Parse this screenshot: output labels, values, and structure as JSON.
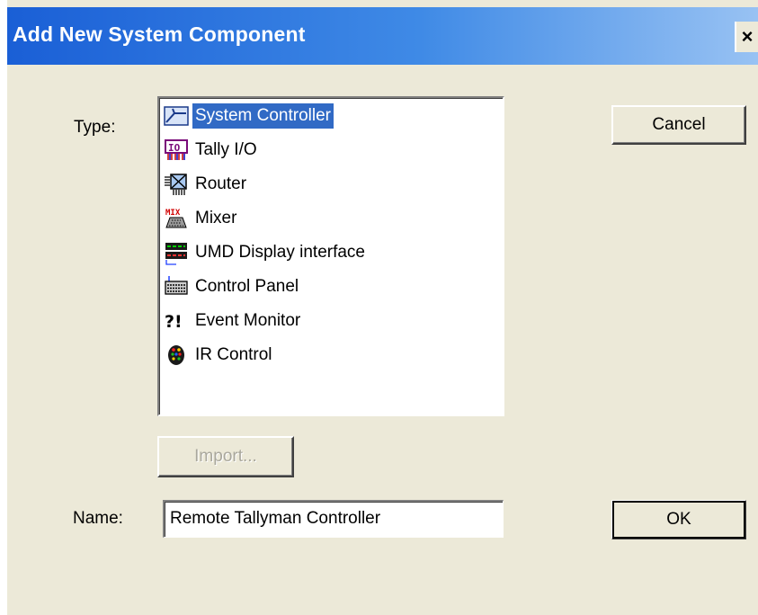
{
  "dialog": {
    "title": "Add New System Component",
    "close_label": "×"
  },
  "type_label": "Type:",
  "name_label": "Name:",
  "type_list": {
    "items": [
      {
        "label": "System Controller",
        "icon": "system-controller-icon",
        "selected": true
      },
      {
        "label": "Tally I/O",
        "icon": "tally-io-icon",
        "selected": false
      },
      {
        "label": "Router",
        "icon": "router-icon",
        "selected": false
      },
      {
        "label": "Mixer",
        "icon": "mixer-icon",
        "selected": false
      },
      {
        "label": "UMD Display interface",
        "icon": "umd-display-icon",
        "selected": false
      },
      {
        "label": "Control Panel",
        "icon": "control-panel-icon",
        "selected": false
      },
      {
        "label": "Event Monitor",
        "icon": "event-monitor-icon",
        "selected": false
      },
      {
        "label": "IR Control",
        "icon": "ir-control-icon",
        "selected": false
      }
    ]
  },
  "buttons": {
    "cancel": "Cancel",
    "import": "Import...",
    "ok": "OK"
  },
  "name_field": {
    "value": "Remote Tallyman Controller"
  },
  "colors": {
    "titlebar_start": "#1a5fd6",
    "dialog_bg": "#ece9d8",
    "selection": "#316ac5"
  }
}
